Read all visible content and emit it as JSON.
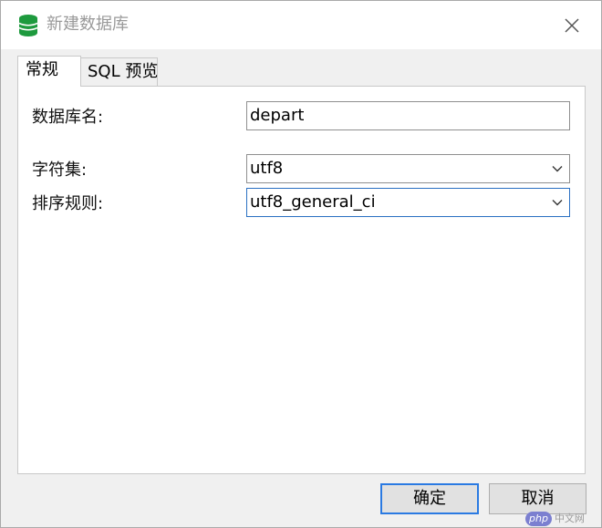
{
  "window": {
    "title": "新建数据库"
  },
  "tabs": [
    {
      "label": "常规",
      "active": true
    },
    {
      "label": "SQL 预览",
      "active": false
    }
  ],
  "form": {
    "db_name": {
      "label": "数据库名:",
      "value": "depart"
    },
    "charset": {
      "label": "字符集:",
      "value": "utf8"
    },
    "collation": {
      "label": "排序规则:",
      "value": "utf8_general_ci"
    }
  },
  "buttons": {
    "ok": "确定",
    "cancel": "取消"
  },
  "watermark": {
    "badge": "php",
    "text": "中文网"
  },
  "colors": {
    "accent": "#2a7ae2",
    "db_icon": "#1e9a3e"
  }
}
